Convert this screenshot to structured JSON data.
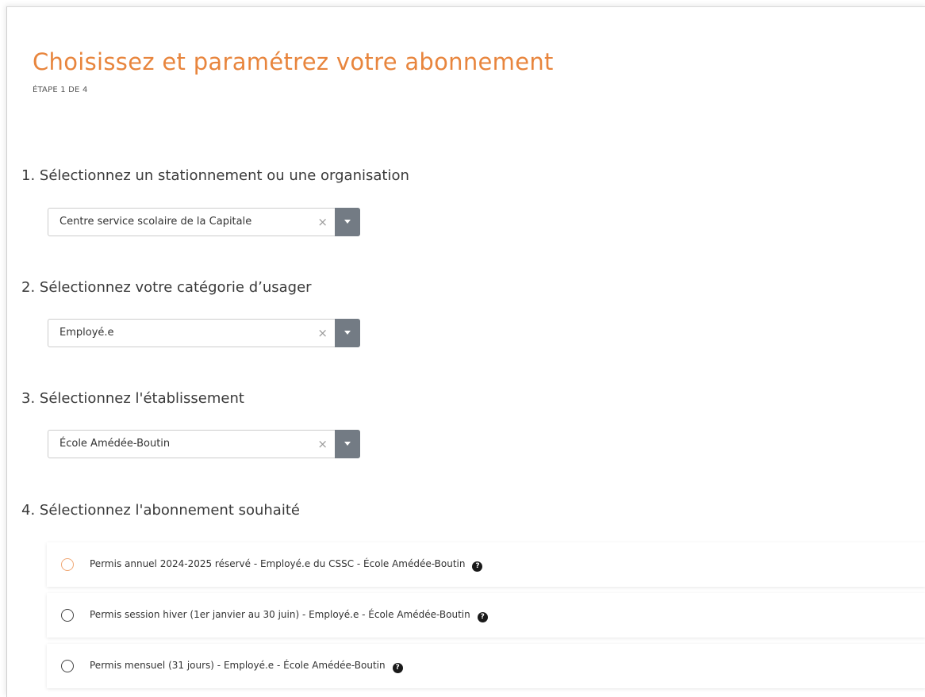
{
  "page": {
    "title": "Choisissez et paramétrez votre abonnement",
    "step": "ÉTAPE 1 DE 4"
  },
  "colors": {
    "accent": "#e8853d",
    "select_arrow_bg": "#737b84",
    "radio_highlight": "#f0a774"
  },
  "sections": {
    "parking": {
      "heading": "1. Sélectionnez un stationnement ou une organisation",
      "value": "Centre service scolaire de la Capitale",
      "clear_glyph": "×"
    },
    "category": {
      "heading": "2. Sélectionnez votre catégorie d’usager",
      "value": "Employé.e",
      "clear_glyph": "×"
    },
    "establishment": {
      "heading": "3. Sélectionnez l'établissement",
      "value": "École Amédée-Boutin",
      "clear_glyph": "×"
    },
    "subscription": {
      "heading": "4. Sélectionnez l'abonnement souhaité",
      "options": [
        {
          "label": "Permis annuel 2024-2025 réservé - Employé.e du CSSC - École Amédée-Boutin",
          "help_icon": "question-circle-icon"
        },
        {
          "label": "Permis session hiver (1er janvier au 30 juin) - Employé.e - École Amédée-Boutin",
          "help_icon": "question-circle-icon"
        },
        {
          "label": "Permis mensuel (31 jours) - Employé.e - École Amédée-Boutin",
          "help_icon": "question-circle-icon"
        }
      ]
    }
  },
  "icons": {
    "help": "?"
  }
}
